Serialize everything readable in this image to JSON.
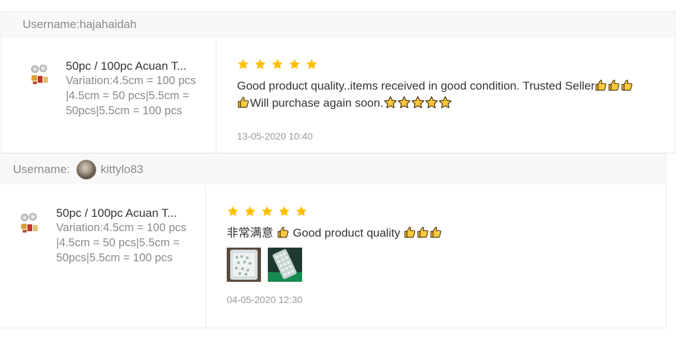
{
  "reviews": [
    {
      "username_label": "Username:",
      "username": "hajahaidah",
      "product_name": "50pc / 100pc Acuan T...",
      "variation": "Variation:4.5cm = 100 pcs|4.5cm = 50 pcs|5.5cm = 50pcs|5.5cm = 100 pcs",
      "rating": 5,
      "comment_part1": "Good product quality..items received in good condition. Trusted Seller",
      "comment_part2": "Will purchase again soon.",
      "timestamp": "13-05-2020 10:40"
    },
    {
      "username_label": "Username: ",
      "username": "kittylo83",
      "product_name": "50pc / 100pc Acuan T...",
      "variation": "Variation:4.5cm = 100 pcs|4.5cm = 50 pcs|5.5cm = 50pcs|5.5cm = 100 pcs",
      "rating": 5,
      "comment_part1": "非常满意 ",
      "comment_part2": " Good product quality ",
      "photos": [
        "review-photo-1",
        "review-photo-2"
      ],
      "timestamp": "04-05-2020 12:30"
    }
  ],
  "colors": {
    "star": "#ffbf00",
    "header_bg": "#f8f8f8",
    "muted_text": "#8a8a8a",
    "border": "#ececec"
  },
  "icons": {
    "rating_star": "star-icon",
    "thumbs_up": "thumbs-up-emoji",
    "star_emoji": "star-emoji"
  }
}
